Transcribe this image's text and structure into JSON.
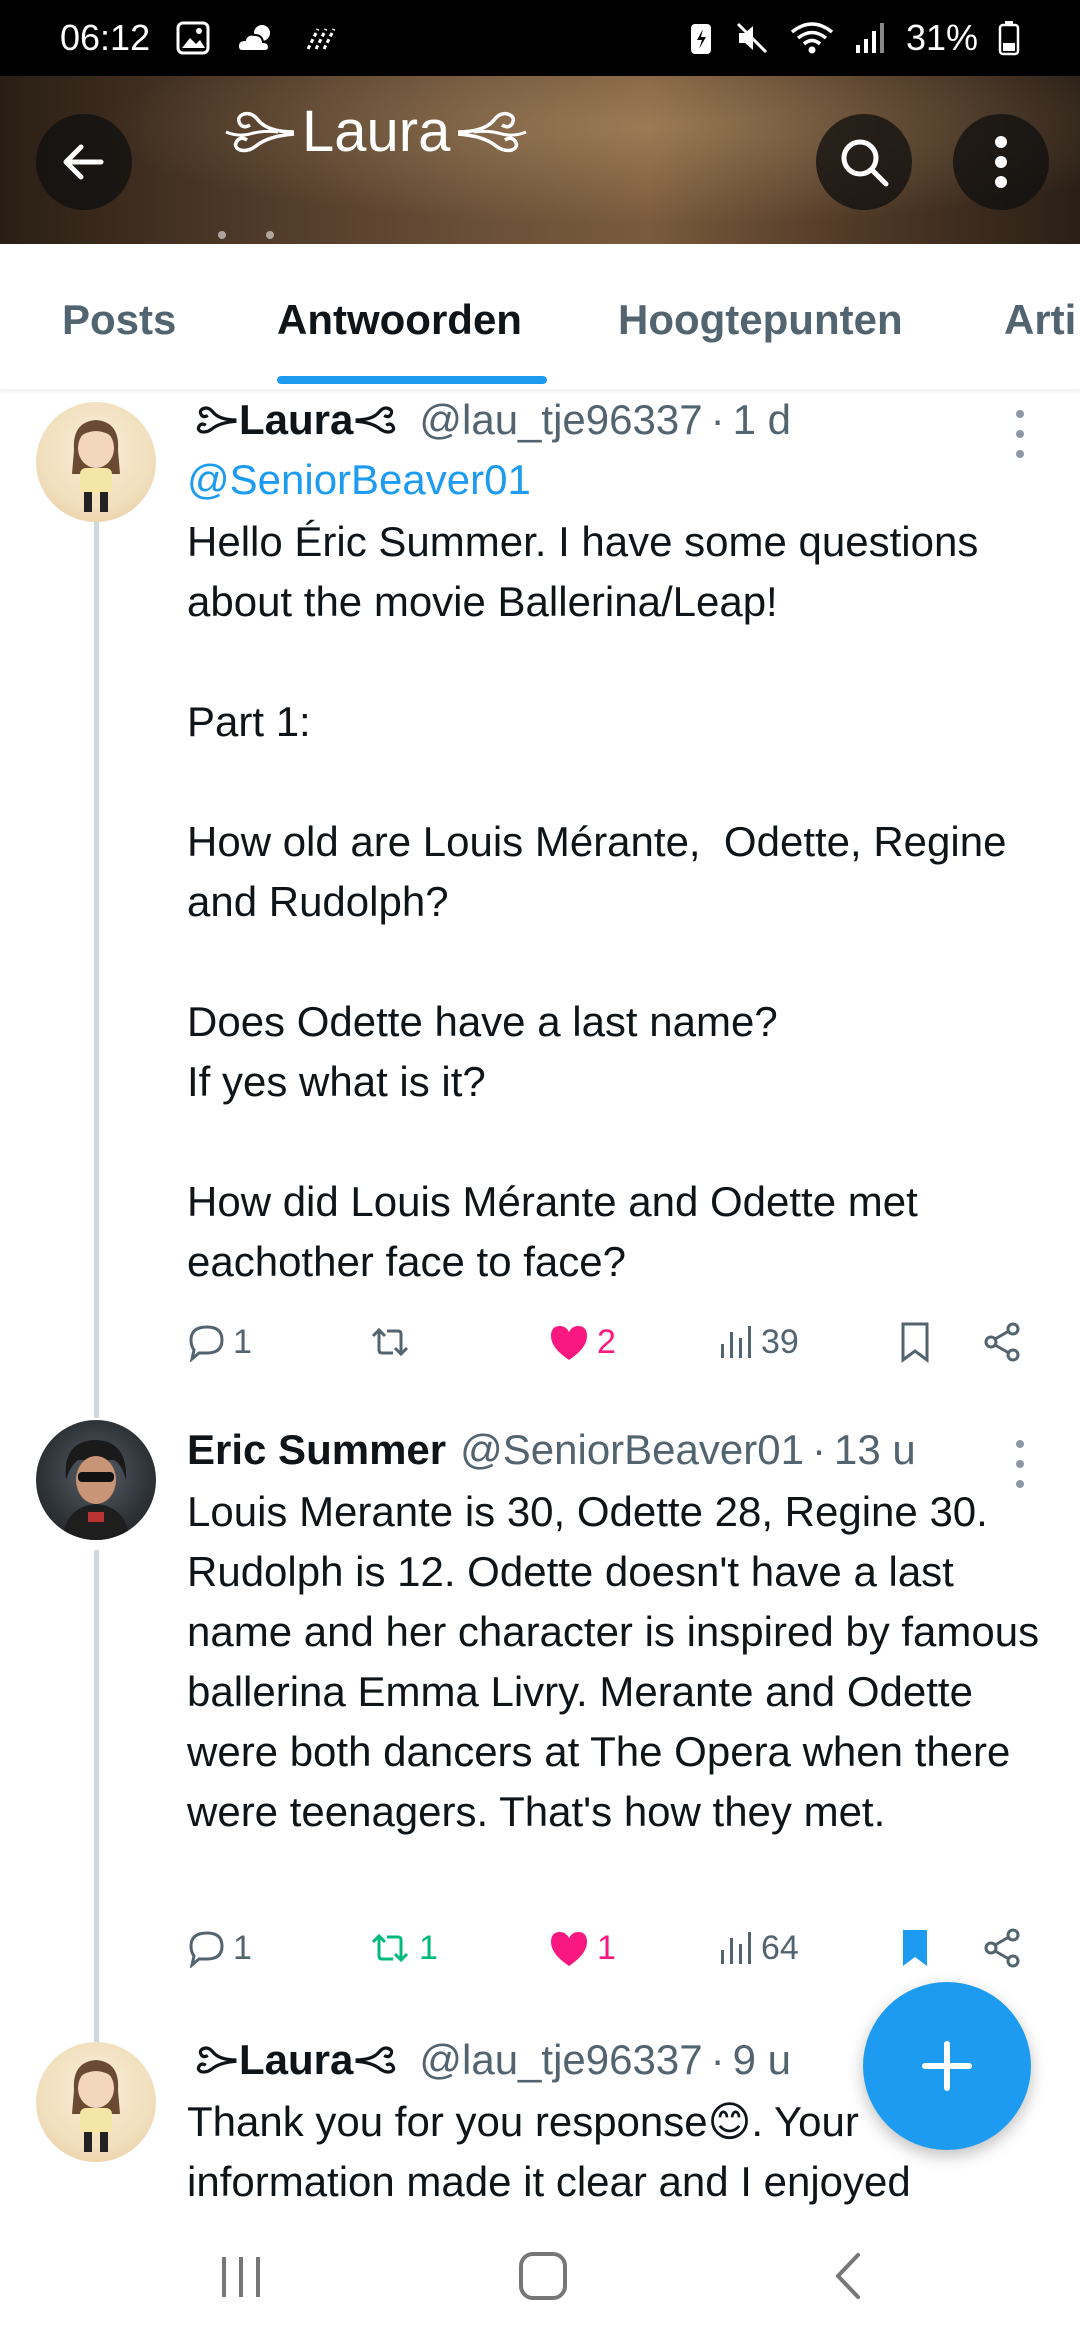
{
  "status_bar": {
    "time": "06:12",
    "battery": "31%",
    "icons": [
      "gallery-icon",
      "weather-icon",
      "nfc-icon",
      "battery-saver-icon",
      "mute-icon",
      "wifi-icon",
      "signal-icon",
      "battery-icon"
    ]
  },
  "header": {
    "title": "Laura",
    "back_icon": "arrow-left-icon",
    "search_icon": "search-icon",
    "more_icon": "more-vertical-icon"
  },
  "tabs": [
    {
      "label": "Posts",
      "active": false
    },
    {
      "label": "Antwoorden",
      "active": true
    },
    {
      "label": "Hoogtepunten",
      "active": false
    },
    {
      "label": "Arti",
      "active": false
    }
  ],
  "colors": {
    "accent": "#1d9bf0",
    "like": "#f91880",
    "retweet": "#00ba7c",
    "muted": "#536471",
    "text": "#0f1419"
  },
  "tweets": [
    {
      "name": "Laura",
      "handle": "@lau_tje96337",
      "time": "1 d",
      "mention": "@SeniorBeaver01",
      "text": "Hello Éric Summer. I have some questions about the movie Ballerina/Leap!\n\nPart 1:\n\nHow old are Louis Mérante,  Odette, Regine and Rudolph?\n\nDoes Odette have a last name?\nIf yes what is it?\n\nHow did Louis Mérante and Odette met eachother face to face?",
      "replies": "1",
      "retweets": "",
      "likes": "2",
      "views": "39",
      "liked": true,
      "retweeted": false,
      "bookmarked": false
    },
    {
      "name": "Eric Summer",
      "handle": "@SeniorBeaver01",
      "time": "13 u",
      "text": "Louis Merante is 30, Odette 28, Regine 30. Rudolph is 12. Odette doesn't have a last name and her character is inspired by famous ballerina Emma Livry. Merante and Odette were both dancers at The Opera when there were teenagers. That's how they met.",
      "replies": "1",
      "retweets": "1",
      "likes": "1",
      "views": "64",
      "liked": true,
      "retweeted": true,
      "bookmarked": true
    },
    {
      "name": "Laura",
      "handle": "@lau_tje96337",
      "time": "9 u",
      "text": "Thank you for you response😊. Your information made it clear and I enjoyed"
    }
  ],
  "fab": {
    "icon": "plus-icon",
    "label": "+"
  },
  "nav_bar": {
    "icons": [
      "recent-apps-icon",
      "home-icon",
      "back-icon"
    ]
  },
  "separator": "·"
}
